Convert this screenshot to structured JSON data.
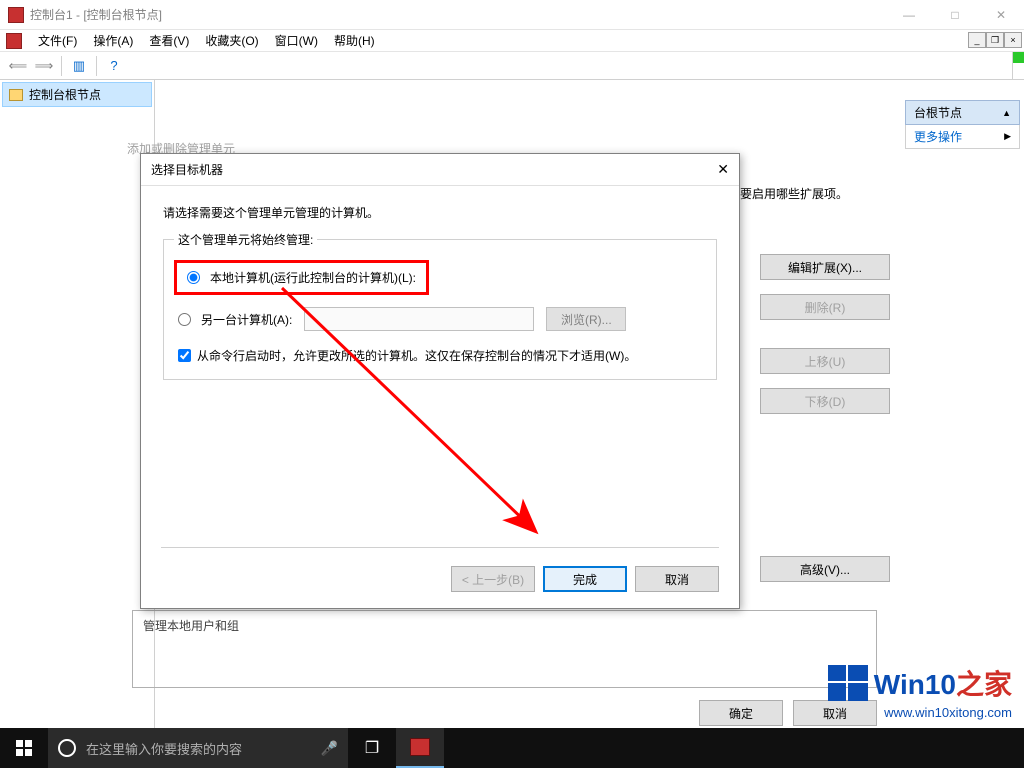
{
  "titlebar": {
    "title": "控制台1 - [控制台根节点]"
  },
  "menu": {
    "file": "文件(F)",
    "action": "操作(A)",
    "view": "查看(V)",
    "favorites": "收藏夹(O)",
    "window": "窗口(W)",
    "help": "帮助(H)"
  },
  "tree": {
    "root": "控制台根节点"
  },
  "bg_dialog": {
    "title_hint": "添加或删除管理单元",
    "right_text": "要启用哪些扩展项。",
    "edit_ext": "编辑扩展(X)...",
    "delete": "删除(R)",
    "move_up": "上移(U)",
    "move_down": "下移(D)",
    "advanced": "高级(V)...",
    "description": "管理本地用户和组",
    "ok": "确定",
    "cancel": "取消"
  },
  "right_panel": {
    "header": "台根节点",
    "more": "更多操作"
  },
  "modal": {
    "title": "选择目标机器",
    "instruction": "请选择需要这个管理单元管理的计算机。",
    "group_legend": "这个管理单元将始终管理:",
    "radio_local": "本地计算机(运行此控制台的计算机)(L):",
    "radio_other": "另一台计算机(A):",
    "browse": "浏览(R)...",
    "checkbox_text": "从命令行启动时，允许更改所选的计算机。这仅在保存控制台的情况下才适用(W)。",
    "back": "< 上一步(B)",
    "finish": "完成",
    "cancel": "取消"
  },
  "taskbar": {
    "search_placeholder": "在这里输入你要搜索的内容"
  },
  "watermark": {
    "brand1": "Win10",
    "brand2": "之家",
    "url": "www.win10xitong.com"
  }
}
